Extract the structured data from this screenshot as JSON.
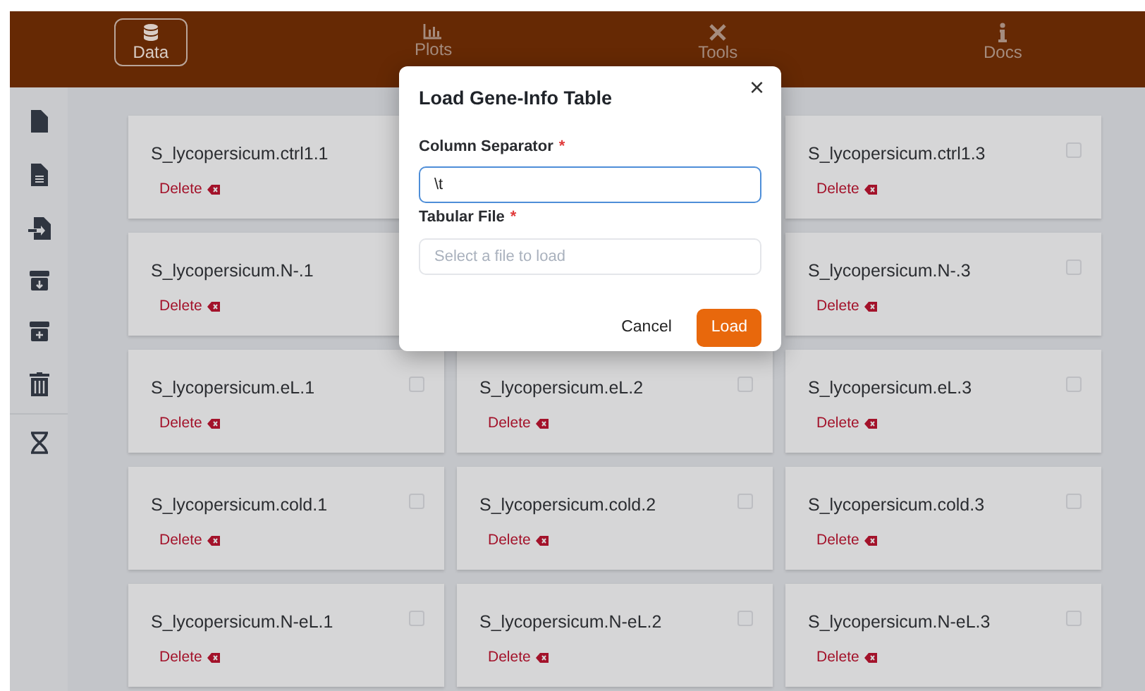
{
  "nav": [
    {
      "label": "Data",
      "selected": true
    },
    {
      "label": "Plots",
      "selected": false
    },
    {
      "label": "Tools",
      "selected": false
    },
    {
      "label": "Docs",
      "selected": false
    }
  ],
  "rows": [
    [
      {
        "name": "S_lycopersicum.ctrl1.1",
        "action": "Delete"
      },
      {
        "name": "S_lycopersicum.ctrl1.3",
        "action": "Delete",
        "checked": false
      }
    ],
    [
      {
        "name": "S_lycopersicum.N-.1",
        "action": "Delete"
      },
      {
        "name": "S_lycopersicum.N-.3",
        "action": "Delete",
        "checked": false
      }
    ],
    [
      {
        "name": "S_lycopersicum.eL.1",
        "action": "Delete",
        "checked": false
      },
      {
        "name": "S_lycopersicum.eL.2",
        "action": "Delete",
        "checked": false
      },
      {
        "name": "S_lycopersicum.eL.3",
        "action": "Delete",
        "checked": false
      }
    ],
    [
      {
        "name": "S_lycopersicum.cold.1",
        "action": "Delete",
        "checked": false
      },
      {
        "name": "S_lycopersicum.cold.2",
        "action": "Delete",
        "checked": false
      },
      {
        "name": "S_lycopersicum.cold.3",
        "action": "Delete",
        "checked": false
      }
    ],
    [
      {
        "name": "S_lycopersicum.N-eL.1",
        "action": "Delete",
        "checked": false
      },
      {
        "name": "S_lycopersicum.N-eL.2",
        "action": "Delete",
        "checked": false
      },
      {
        "name": "S_lycopersicum.N-eL.3",
        "action": "Delete",
        "checked": false
      }
    ]
  ],
  "dialog": {
    "title": "Load Gene-Info Table",
    "close": "×",
    "fields": [
      {
        "label": "Column Separator",
        "required": "*",
        "value": "\\t",
        "focused": true
      },
      {
        "label": "Tabular File",
        "required": "*",
        "placeholder": "Select a file to load",
        "focused": false
      }
    ],
    "buttons": [
      {
        "label": "Cancel",
        "kind": "secondary"
      },
      {
        "label": "Load",
        "kind": "primary"
      }
    ]
  }
}
